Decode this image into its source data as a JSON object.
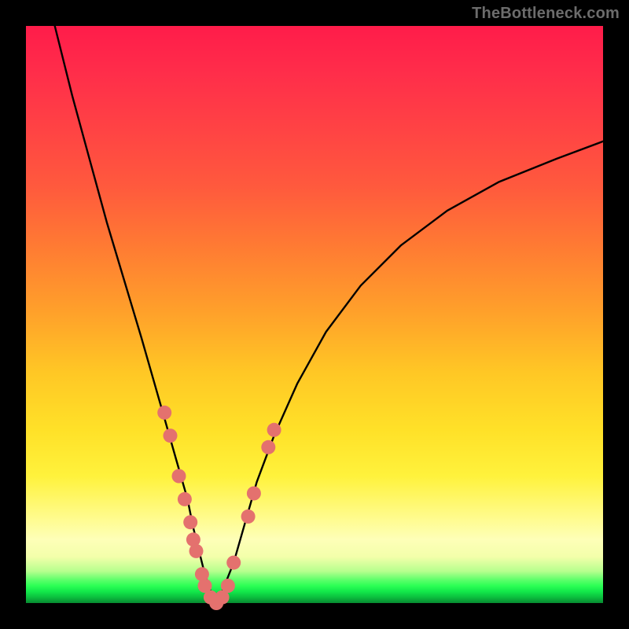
{
  "watermark": "TheBottleneck.com",
  "colors": {
    "frame": "#000000",
    "curve": "#000000",
    "marker": "#e4716e"
  },
  "chart_data": {
    "type": "line",
    "title": "",
    "xlabel": "",
    "ylabel": "",
    "xlim": [
      0,
      100
    ],
    "ylim": [
      0,
      100
    ],
    "note": "Y is bottleneck percentage (0 at bottom, 100 at top). X is an unlabeled horizontal index. Values read off the curve by gridline position.",
    "series": [
      {
        "name": "bottleneck-curve",
        "x": [
          5,
          8,
          11,
          14,
          17,
          20,
          22,
          24,
          26,
          28,
          29,
          30,
          31,
          32,
          33,
          34,
          36,
          38,
          40,
          43,
          47,
          52,
          58,
          65,
          73,
          82,
          92,
          100
        ],
        "y": [
          100,
          88,
          77,
          66,
          56,
          46,
          39,
          32,
          25,
          18,
          13,
          9,
          5,
          2,
          0,
          2,
          7,
          14,
          21,
          29,
          38,
          47,
          55,
          62,
          68,
          73,
          77,
          80
        ]
      }
    ],
    "markers": {
      "name": "highlighted-points",
      "note": "Pink dot markers clustered near the curve's minimum.",
      "points": [
        {
          "x": 24.0,
          "y": 33
        },
        {
          "x": 25.0,
          "y": 29
        },
        {
          "x": 26.5,
          "y": 22
        },
        {
          "x": 27.5,
          "y": 18
        },
        {
          "x": 28.5,
          "y": 14
        },
        {
          "x": 29.0,
          "y": 11
        },
        {
          "x": 29.5,
          "y": 9
        },
        {
          "x": 30.5,
          "y": 5
        },
        {
          "x": 31.0,
          "y": 3
        },
        {
          "x": 32.0,
          "y": 1
        },
        {
          "x": 33.0,
          "y": 0
        },
        {
          "x": 34.0,
          "y": 1
        },
        {
          "x": 35.0,
          "y": 3
        },
        {
          "x": 36.0,
          "y": 7
        },
        {
          "x": 38.5,
          "y": 15
        },
        {
          "x": 39.5,
          "y": 19
        },
        {
          "x": 42.0,
          "y": 27
        },
        {
          "x": 43.0,
          "y": 30
        }
      ]
    }
  }
}
